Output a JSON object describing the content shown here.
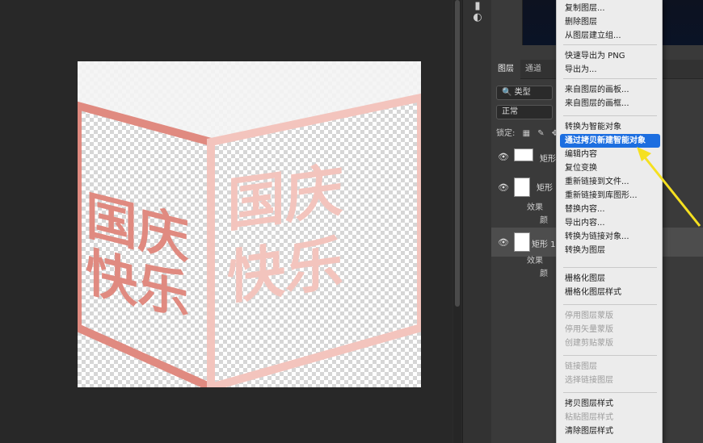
{
  "canvas": {
    "cube_text_left": [
      "国庆",
      "快乐"
    ],
    "cube_text_right": [
      "国庆",
      "快乐"
    ],
    "colors": {
      "left_face": "#e08a80",
      "right_face": "#f3c4bd",
      "top_face": "#f2f2f2"
    }
  },
  "panel": {
    "tabs": [
      "图层",
      "通道"
    ],
    "kind_filter": "类型",
    "blend_mode": "正常",
    "lock_label": "锁定:",
    "layers": [
      {
        "name": "矩形"
      },
      {
        "name": "矩形",
        "effects_label": "效果",
        "sub_label": "颜"
      },
      {
        "name": "矩形 1",
        "effects_label": "效果",
        "sub_label": "颜"
      }
    ]
  },
  "menu": {
    "items": [
      {
        "label": "复制图层..."
      },
      {
        "label": "删除图层"
      },
      {
        "label": "从图层建立组..."
      },
      {
        "label": "快速导出为 PNG"
      },
      {
        "label": "导出为..."
      },
      {
        "label": "来自图层的画板..."
      },
      {
        "label": "来自图层的画框..."
      },
      {
        "label": "转换为智能对象"
      },
      {
        "label": "通过拷贝新建智能对象"
      },
      {
        "label": "编辑内容"
      },
      {
        "label": "复位变换"
      },
      {
        "label": "重新链接到文件..."
      },
      {
        "label": "重新链接到库图形..."
      },
      {
        "label": "替换内容..."
      },
      {
        "label": "导出内容..."
      },
      {
        "label": "转换为链接对象..."
      },
      {
        "label": "转换为图层"
      },
      {
        "label": "栅格化图层"
      },
      {
        "label": "栅格化图层样式"
      },
      {
        "label": "停用图层蒙版"
      },
      {
        "label": "停用矢量蒙版"
      },
      {
        "label": "创建剪贴蒙版"
      },
      {
        "label": "链接图层"
      },
      {
        "label": "选择链接图层"
      },
      {
        "label": "拷贝图层样式"
      },
      {
        "label": "粘贴图层样式"
      },
      {
        "label": "清除图层样式"
      }
    ],
    "highlighted_index": 8,
    "disabled_indices": [
      19,
      20,
      21,
      22,
      23,
      25
    ],
    "highlight_color": "#1c6ee0"
  },
  "icons": {
    "eye": "eye-icon",
    "annotation": "yellow-arrow"
  }
}
